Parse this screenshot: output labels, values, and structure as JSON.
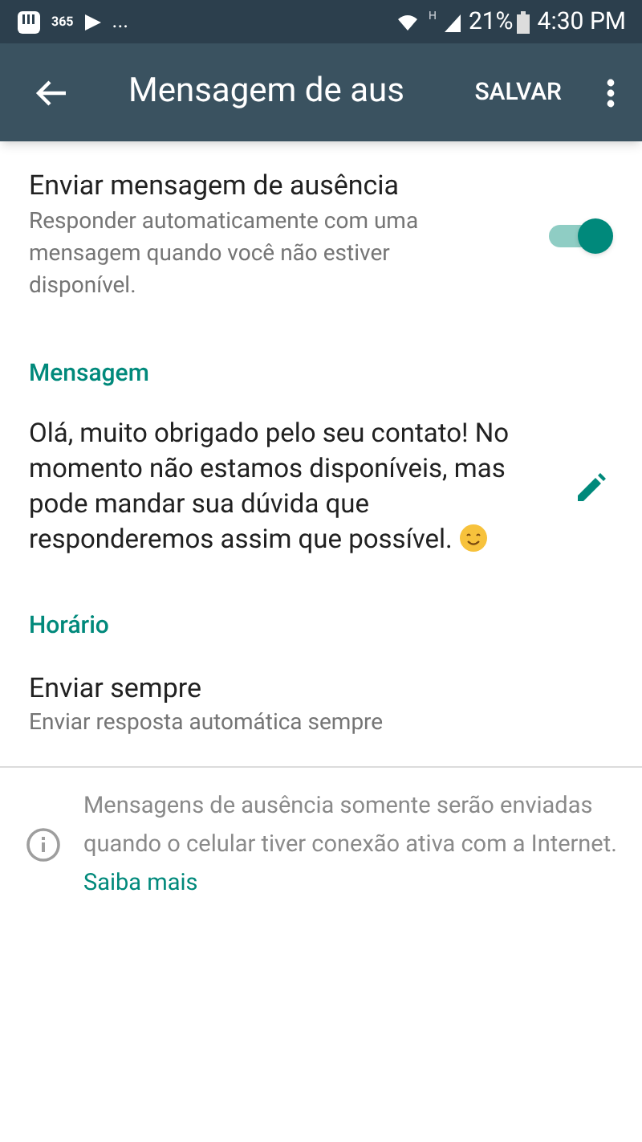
{
  "status_bar": {
    "notification_label": "365",
    "more": "...",
    "network": "H",
    "battery": "21%",
    "time": "4:30 PM"
  },
  "toolbar": {
    "title": "Mensagem de aus",
    "action": "SALVAR"
  },
  "away_setting": {
    "title": "Enviar mensagem de ausência",
    "description": "Responder automaticamente com uma mensagem quando você não estiver disponível.",
    "on": true
  },
  "message_section": {
    "heading": "Mensagem",
    "text": "Olá, muito obrigado pelo seu contato! No momento não estamos disponíveis, mas pode mandar sua dúvida que responderemos assim que possível."
  },
  "schedule_section": {
    "heading": "Horário",
    "title": "Enviar sempre",
    "description": "Enviar resposta automática sempre"
  },
  "info": {
    "text": "Mensagens de ausência somente serão enviadas quando o celular tiver conexão ativa com a Internet.",
    "link": "Saiba mais"
  }
}
